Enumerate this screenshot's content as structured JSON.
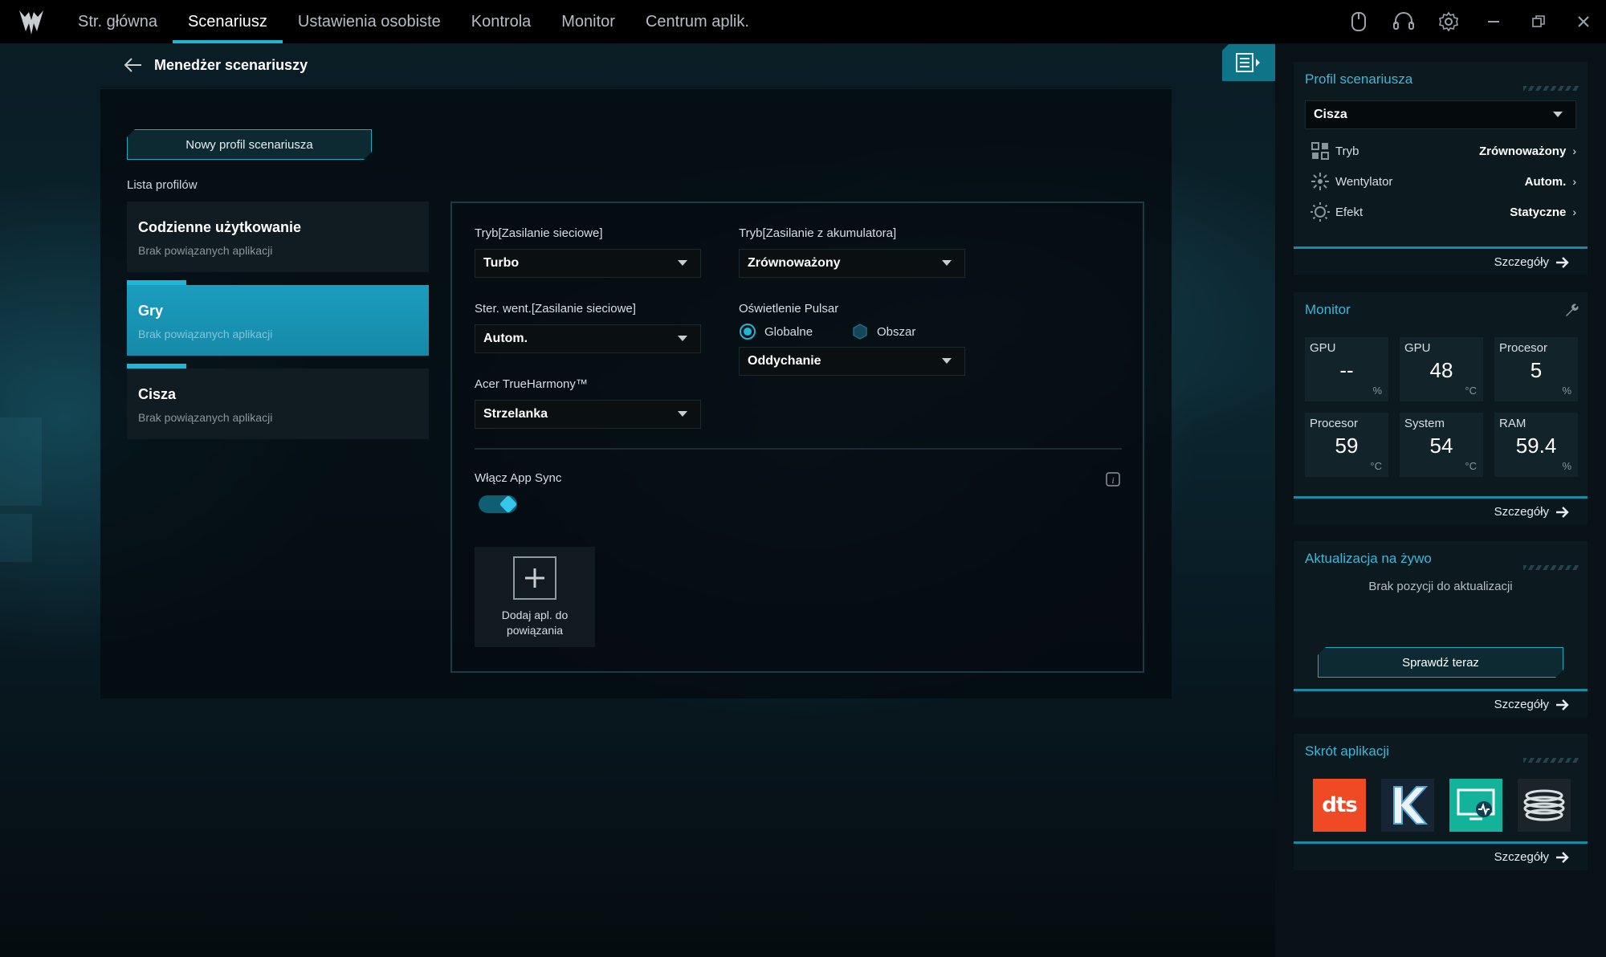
{
  "nav": {
    "items": [
      {
        "label": "Str. główna"
      },
      {
        "label": "Scenariusz"
      },
      {
        "label": "Ustawienia osobiste"
      },
      {
        "label": "Kontrola"
      },
      {
        "label": "Monitor"
      },
      {
        "label": "Centrum aplik."
      }
    ],
    "active_index": 1
  },
  "header": {
    "title": "Menedżer scenariuszy"
  },
  "profiles": {
    "new_button": "Nowy profil scenariusza",
    "list_label": "Lista profilów",
    "items": [
      {
        "name": "Codzienne użytkowanie",
        "sub": "Brak powiązanych aplikacji"
      },
      {
        "name": "Gry",
        "sub": "Brak powiązanych aplikacji"
      },
      {
        "name": "Cisza",
        "sub": "Brak powiązanych aplikacji"
      }
    ],
    "selected": "Gry"
  },
  "settings": {
    "mode_ac_label": "Tryb[Zasilanie sieciowe]",
    "mode_ac_value": "Turbo",
    "mode_dc_label": "Tryb[Zasilanie z akumulatora]",
    "mode_dc_value": "Zrównoważony",
    "fan_label": "Ster. went.[Zasilanie sieciowe]",
    "fan_value": "Autom.",
    "pulsar_label": "Oświetlenie Pulsar",
    "radio_global": "Globalne",
    "radio_zone": "Obszar",
    "radio_selected": "Globalne",
    "pulsar_value": "Oddychanie",
    "trueharmony_label": "Acer TrueHarmony™",
    "trueharmony_value": "Strzelanka",
    "appsync_label": "Włącz App Sync",
    "appsync_on": true,
    "add_app_label_1": "Dodaj apl. do",
    "add_app_label_2": "powiązania"
  },
  "sidebar": {
    "profile": {
      "title": "Profil scenariusza",
      "selected": "Cisza",
      "rows": [
        {
          "label": "Tryb",
          "value": "Zrównoważony",
          "icon": "grid-icon"
        },
        {
          "label": "Wentylator",
          "value": "Autom.",
          "icon": "fan-icon"
        },
        {
          "label": "Efekt",
          "value": "Statyczne",
          "icon": "sun-icon"
        }
      ],
      "details": "Szczegóły"
    },
    "monitor": {
      "title": "Monitor",
      "cells": [
        {
          "label": "GPU",
          "value": "--",
          "unit": "%"
        },
        {
          "label": "GPU",
          "value": "48",
          "unit": "°C"
        },
        {
          "label": "Procesor",
          "value": "5",
          "unit": "%"
        },
        {
          "label": "Procesor",
          "value": "59",
          "unit": "°C"
        },
        {
          "label": "System",
          "value": "54",
          "unit": "°C"
        },
        {
          "label": "RAM",
          "value": "59.4",
          "unit": "%"
        }
      ],
      "details": "Szczegóły"
    },
    "live_update": {
      "title": "Aktualizacja na żywo",
      "empty": "Brak pozycji do aktualizacji",
      "check_button": "Sprawdź teraz",
      "details": "Szczegóły"
    },
    "shortcuts": {
      "title": "Skrót aplikacji",
      "apps": [
        {
          "name": "dts",
          "icon": "dts-icon",
          "color": "#f04a24"
        },
        {
          "name": "K",
          "icon": "killer-icon",
          "color": "#1a2a3a"
        },
        {
          "name": "monitor",
          "icon": "system-monitor-icon",
          "color": "#12b39a"
        },
        {
          "name": "coil",
          "icon": "coil-icon",
          "color": "#1b2529"
        }
      ],
      "details": "Szczegóły"
    }
  },
  "colors": {
    "accent": "#1fb5d6",
    "title_blue": "#3ab8d8"
  }
}
